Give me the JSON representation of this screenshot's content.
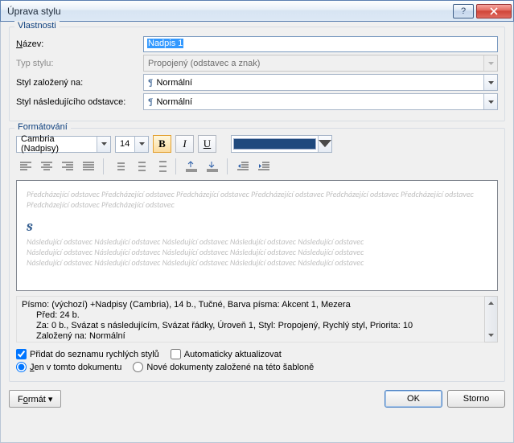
{
  "titlebar": {
    "title": "Úprava stylu"
  },
  "groups": {
    "props": "Vlastnosti",
    "format": "Formátování"
  },
  "props": {
    "name_label_pre": "",
    "name_label": "Název:",
    "name_underline": "N",
    "name_rest": "ázev:",
    "name_value": "Nadpis 1",
    "type_label": "Typ stylu:",
    "type_value": "Propojený (odstavec a znak)",
    "based_label": "Styl založený na:",
    "based_value": "Normální",
    "following_label": "Styl následujícího odstavce:",
    "following_value": "Normální"
  },
  "fmt": {
    "font": "Cambria (Nadpisy)",
    "size": "14",
    "bold": "B",
    "italic": "I",
    "underline": "U",
    "color": "#1f497d"
  },
  "preview": {
    "before": "Předcházející odstavec Předcházející odstavec Předcházející odstavec Předcházející odstavec Předcházející odstavec Předcházející odstavec Předcházející odstavec Předcházející odstavec",
    "sample": "s",
    "after1": "Následující odstavec Následující odstavec Následující odstavec Následující odstavec Následující odstavec",
    "after2": "Následující odstavec Následující odstavec Následující odstavec Následující odstavec Následující odstavec",
    "after3": "Následující odstavec Následující odstavec Následující odstavec Následující odstavec Následující odstavec"
  },
  "description": {
    "l1": "Písmo: (výchozí) +Nadpisy (Cambria), 14 b., Tučné, Barva písma: Akcent 1, Mezera",
    "l2": "Před: 24 b.",
    "l3": "Za: 0 b., Svázat s následujícím, Svázat řádky, Úroveň 1, Styl: Propojený, Rychlý styl, Priorita: 10",
    "l4": "Založený na: Normální"
  },
  "options": {
    "quick_styles": "Přidat do seznamu rychlých stylů",
    "auto_update": "Automaticky aktualizovat",
    "only_doc_pre": "",
    "only_doc_u": "J",
    "only_doc_rest": "en v tomto dokumentu",
    "new_template": "Nové dokumenty založené na této šabloně"
  },
  "buttons": {
    "format_pre": "F",
    "format_u": "o",
    "format_rest": "rmát",
    "ok": "OK",
    "cancel": "Storno"
  }
}
